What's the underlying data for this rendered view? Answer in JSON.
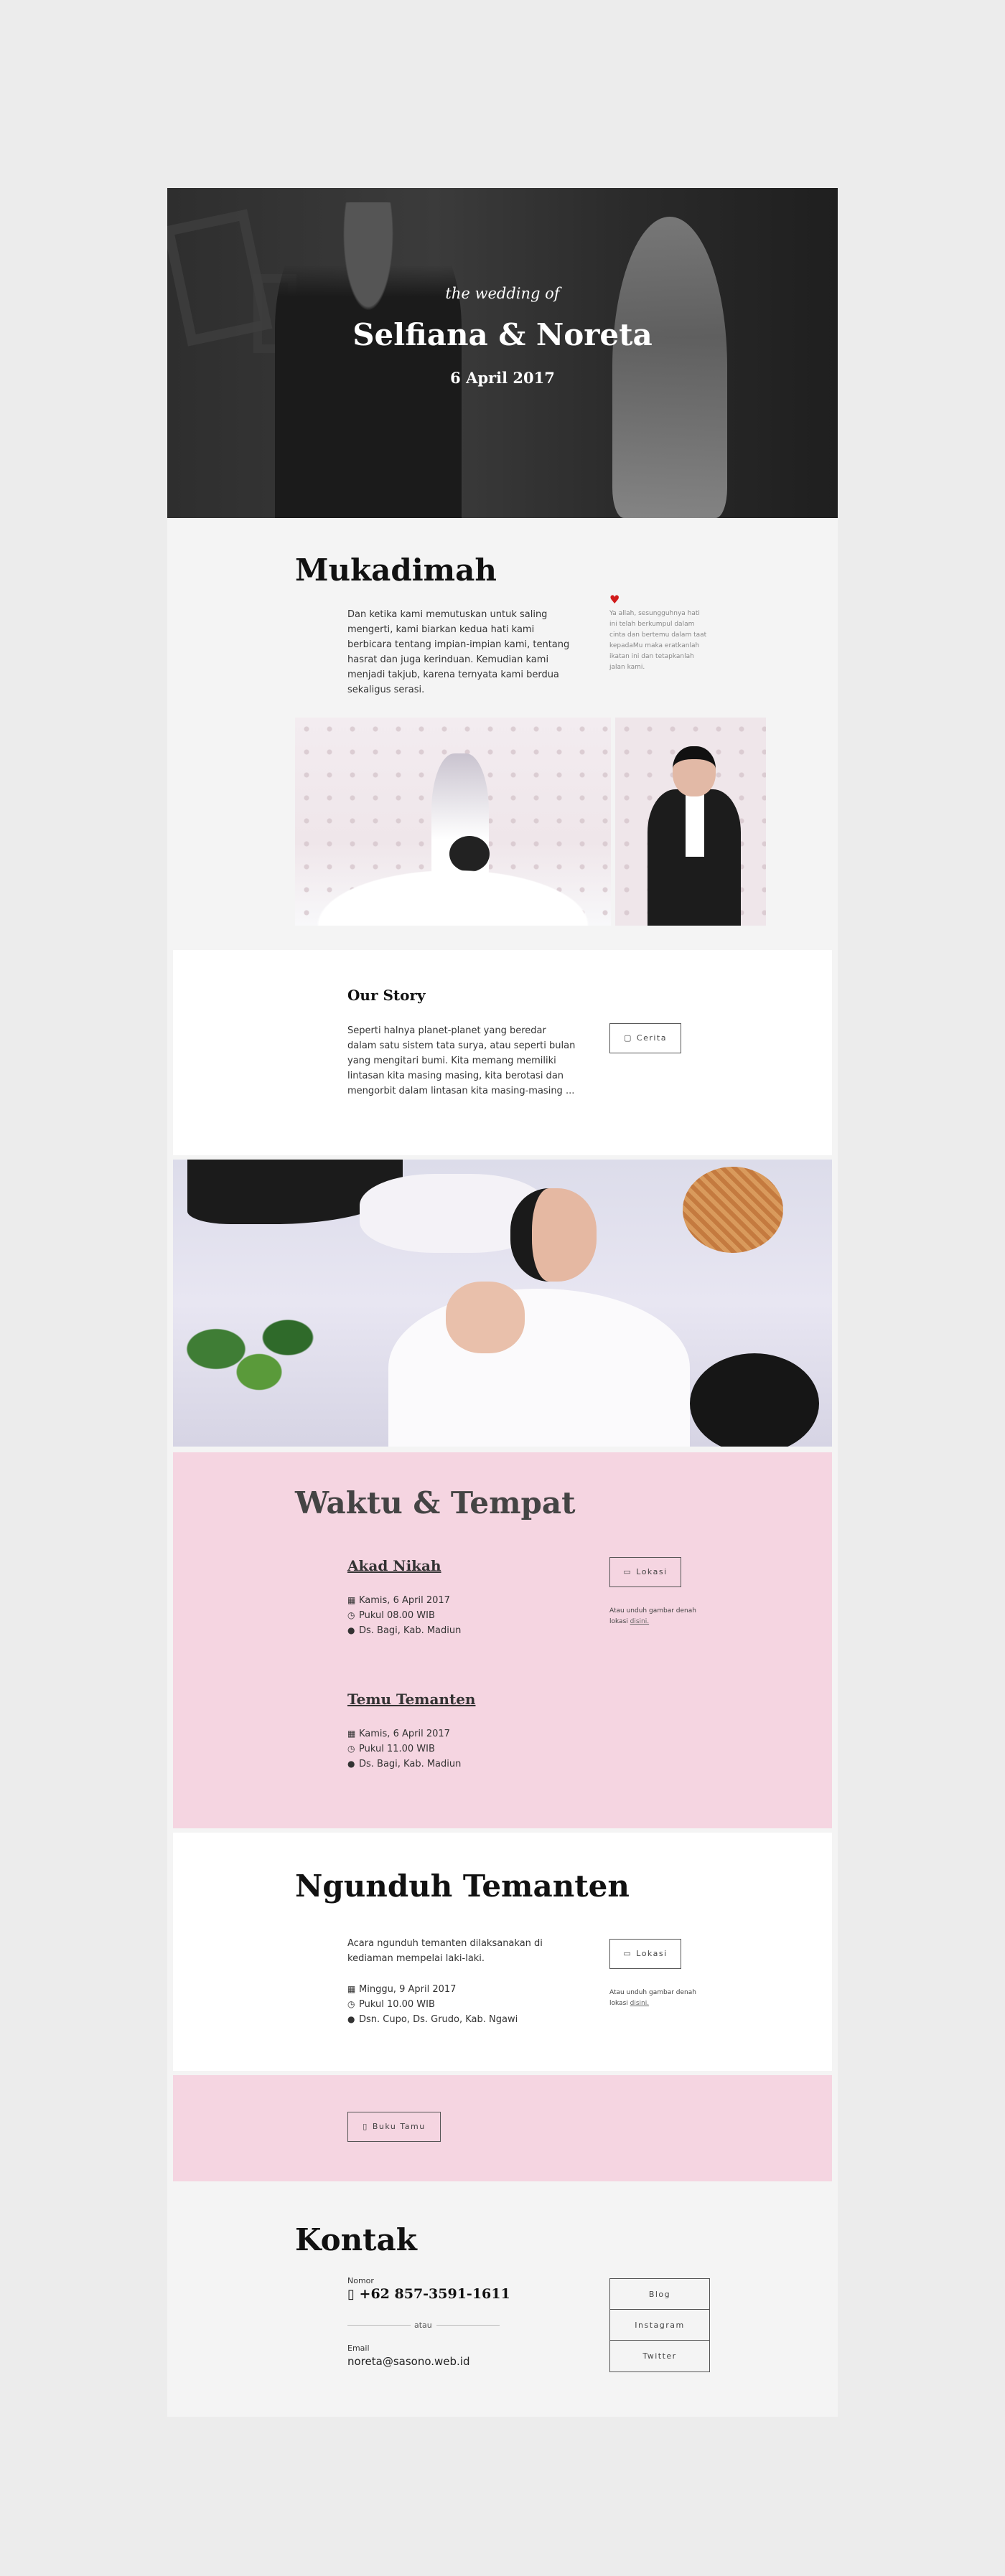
{
  "hero": {
    "subtitle": "the wedding of",
    "title": "Selfiana & Noreta",
    "date": "6 April 2017"
  },
  "mukadimah": {
    "heading": "Mukadimah",
    "text": "Dan ketika kami memutuskan untuk saling mengerti, kami biarkan kedua hati kami berbicara tentang impian-impian kami, tentang hasrat dan juga kerinduan. Kemudian kami menjadi takjub, karena ternyata kami berdua sekaligus serasi.",
    "side_note": "Ya allah, sesungguhnya hati ini telah berkumpul dalam cinta dan bertemu dalam taat kepadaMu maka eratkanlah ikatan ini dan tetapkanlah jalan kami.",
    "heart_color": "#d11a1a"
  },
  "story": {
    "heading": "Our Story",
    "text": "Seperti halnya planet-planet yang beredar dalam satu sistem tata surya, atau seperti bulan yang mengitari bumi. Kita memang memiliki lintasan kita masing masing, kita berotasi dan mengorbit dalam lintasan kita masing-masing ...",
    "button": "Cerita"
  },
  "waktu": {
    "heading": "Waktu & Tempat",
    "akad": {
      "title": "Akad Nikah",
      "date": "Kamis, 6 April 2017",
      "time": "Pukul 08.00 WIB",
      "place": "Ds. Bagi, Kab. Madiun"
    },
    "temu": {
      "title": "Temu Temanten",
      "date": "Kamis, 6 April 2017",
      "time": "Pukul 11.00 WIB",
      "place": "Ds. Bagi, Kab. Madiun"
    },
    "button": "Lokasi",
    "note_prefix": "Atau unduh gambar denah lokasi ",
    "note_link": "disini."
  },
  "ngunduh": {
    "heading": "Ngunduh Temanten",
    "text": "Acara ngunduh temanten dilaksanakan di kediaman mempelai laki-laki.",
    "date": "Minggu, 9 April 2017",
    "time": "Pukul 10.00 WIB",
    "place": "Dsn. Cupo, Ds. Grudo, Kab. Ngawi",
    "button": "Lokasi",
    "note_prefix": "Atau unduh gambar denah lokasi ",
    "note_link": "disini."
  },
  "guestbook": {
    "button": "Buku Tamu",
    "bg_color": "#f5d5e1"
  },
  "kontak": {
    "heading": "Kontak",
    "phone_label": "Nomor",
    "phone": "+62 857-3591-1611",
    "or": "atau",
    "email_label": "Email",
    "email": "noreta@sasono.web.id",
    "links": [
      "Blog",
      "Instagram",
      "Twitter"
    ]
  }
}
